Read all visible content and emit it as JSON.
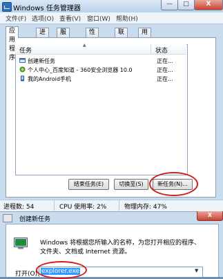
{
  "window": {
    "title": "Windows 任务管理器"
  },
  "title_buttons": {
    "minimize": "—",
    "maximize": "□",
    "close": "X"
  },
  "menu": [
    "文件(F)",
    "选项(O)",
    "查看(V)",
    "窗口(W)",
    "帮助(H)"
  ],
  "tabs": [
    "应用程序",
    "进程",
    "服务",
    "性能",
    "联网",
    "用户"
  ],
  "list": {
    "headers": {
      "task": "任务",
      "status": "状态"
    },
    "rows": [
      {
        "name": "创建新任务",
        "status": "正在...",
        "icon": "new-task-icon"
      },
      {
        "name": "个人中心_百度知道 - 360安全浏览器 10.0",
        "status": "正在...",
        "icon": "browser-icon"
      },
      {
        "name": "我的Android手机",
        "status": "正在...",
        "icon": "phone-icon"
      }
    ]
  },
  "buttons": {
    "end_task": "结束任务(E)",
    "switch_to": "切换至(S)",
    "new_task": "新任务(N)..."
  },
  "status_bar": {
    "processes": "进程数: 54",
    "cpu": "CPU 使用率: 2%",
    "memory": "物理内存: 47%"
  },
  "dialog": {
    "title": "创建新任务",
    "close": "X",
    "message_line1": "Windows 将根据您所输入的名称，为您打开相应的程序、",
    "message_line2": "文件夹、文档或 Internet 资源。",
    "open_label": "打开(O):",
    "open_value": "explorer.exe"
  },
  "colors": {
    "highlight": "#3399ff",
    "annotation_ring": "#d21d1d"
  }
}
